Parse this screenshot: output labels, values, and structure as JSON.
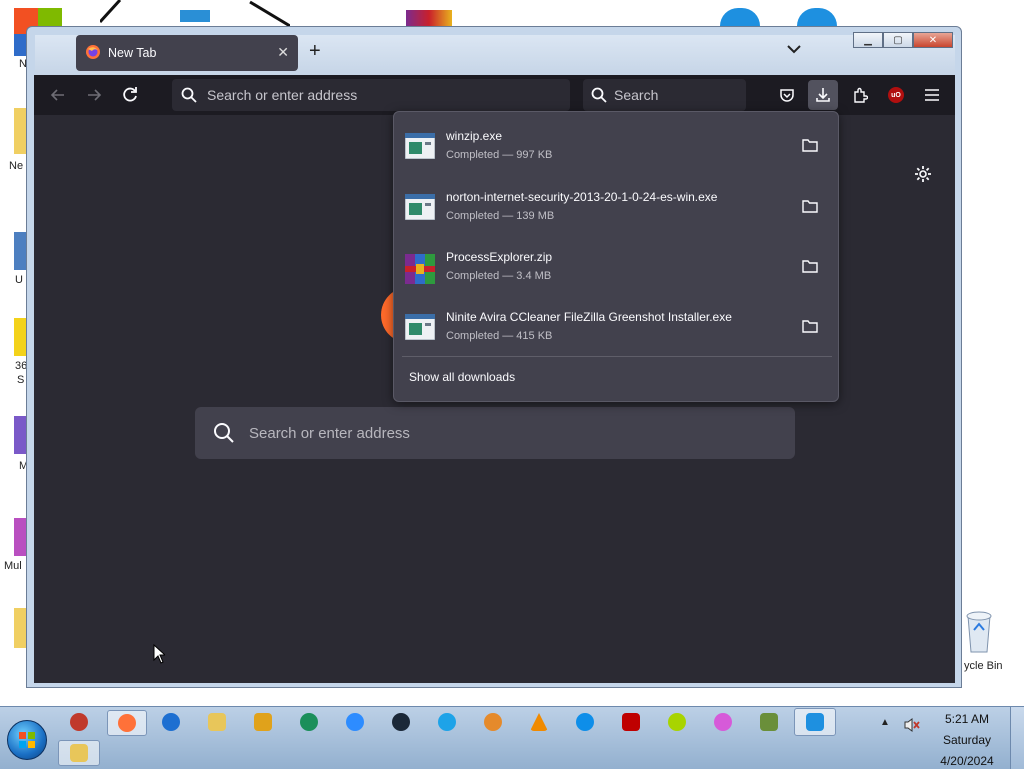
{
  "browser": {
    "tab_title": "New Tab",
    "url_placeholder": "Search or enter address",
    "search_placeholder": "Search",
    "content_search_placeholder": "Search or enter address"
  },
  "downloads": {
    "items": [
      {
        "name": "winzip.exe",
        "status": "Completed — 997 KB",
        "icon": "exe-file-icon"
      },
      {
        "name": "norton-internet-security-2013-20-1-0-24-es-win.exe",
        "status": "Completed — 139 MB",
        "icon": "exe-file-icon"
      },
      {
        "name": "ProcessExplorer.zip",
        "status": "Completed — 3.4 MB",
        "icon": "winrar-archive-icon"
      },
      {
        "name": "Ninite Avira CCleaner FileZilla Greenshot Installer.exe",
        "status": "Completed — 415 KB",
        "icon": "exe-file-icon"
      }
    ],
    "show_all_label": "Show all downloads"
  },
  "desktop": {
    "labels": [
      "N",
      "Ne",
      "U",
      "36",
      "S",
      "M",
      "Mul",
      "ycle Bin"
    ]
  },
  "taskbar": {
    "time": "5:21 AM",
    "day": "Saturday",
    "date": "4/20/2024",
    "apps": [
      "firefox",
      "edge",
      "explorer",
      "media",
      "app-green",
      "zoom",
      "steam",
      "ie",
      "shield",
      "vlc",
      "teamviewer",
      "filezilla",
      "plus",
      "itunes",
      "tools",
      "search"
    ]
  },
  "colors": {
    "toolbar": "#1c1b22",
    "content": "#2b2a33",
    "panel": "#42414d",
    "accent": "#ff6a2a"
  }
}
